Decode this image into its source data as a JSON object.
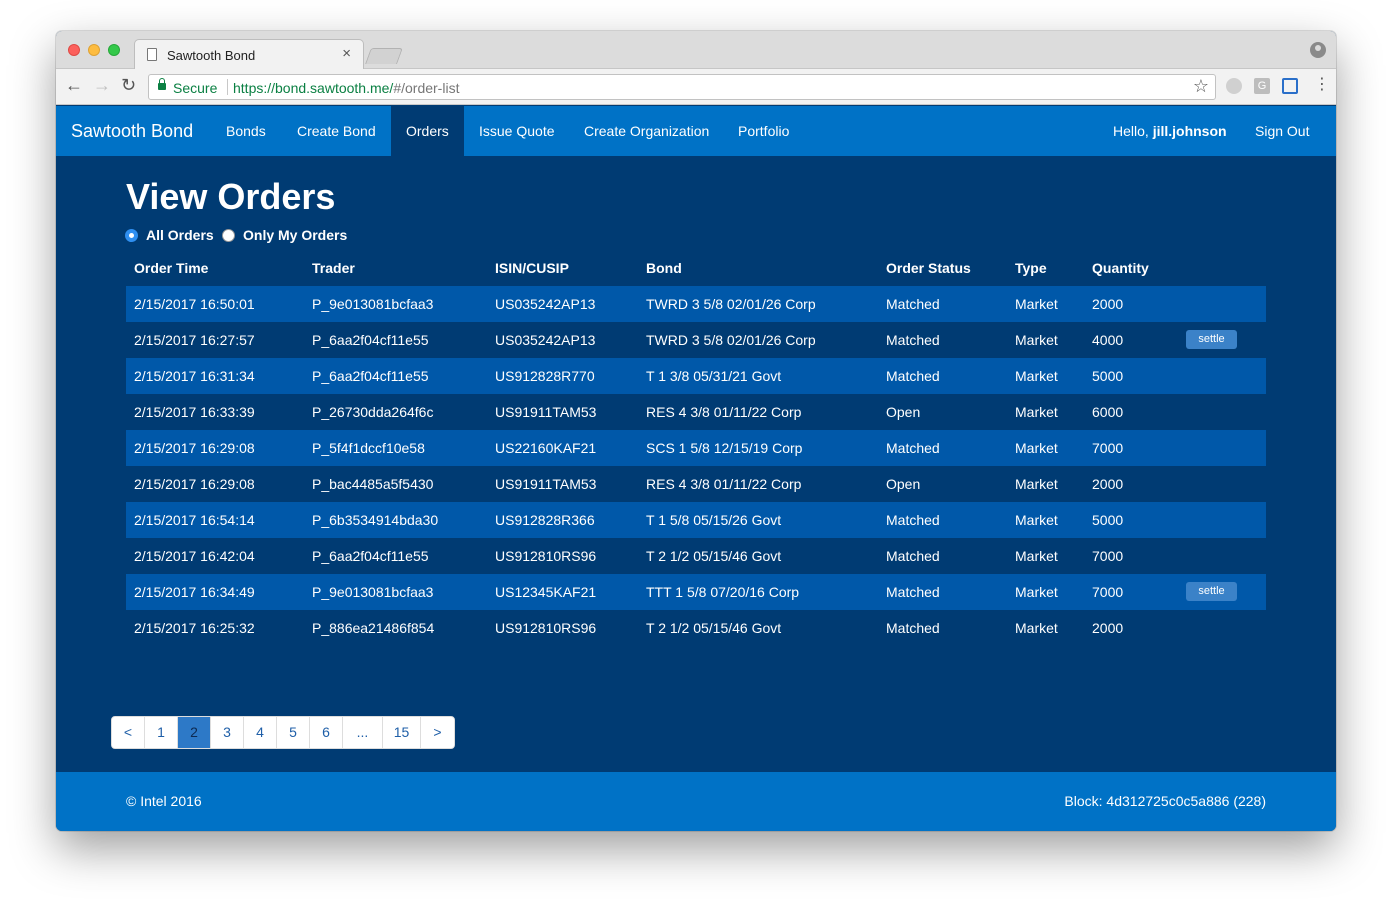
{
  "browser": {
    "tab_title": "Sawtooth Bond",
    "tab_close": "×",
    "secure_label": "Secure",
    "url_origin": "https://bond.sawtooth.me/",
    "url_path": "#/order-list",
    "ext2_label": "G"
  },
  "navbar": {
    "brand": "Sawtooth Bond",
    "items": [
      {
        "label": "Bonds"
      },
      {
        "label": "Create Bond"
      },
      {
        "label": "Orders",
        "active": true
      },
      {
        "label": "Issue Quote"
      },
      {
        "label": "Create Organization"
      },
      {
        "label": "Portfolio"
      }
    ],
    "hello_prefix": "Hello, ",
    "username": "jill.johnson",
    "sign_out": "Sign Out",
    "accent_color": "#0072c6"
  },
  "main": {
    "title": "View Orders",
    "filters": {
      "all_orders": "All Orders",
      "only_my_orders": "Only My Orders",
      "selected": "all_orders"
    },
    "columns": [
      "Order Time",
      "Trader",
      "ISIN/CUSIP",
      "Bond",
      "Order Status",
      "Type",
      "Quantity"
    ],
    "settle_label": "settle",
    "rows": [
      {
        "time": "2/15/2017 16:50:01",
        "trader": "P_9e013081bcfaa3",
        "isin": "US035242AP13",
        "bond": "TWRD 3 5/8 02/01/26 Corp",
        "status": "Matched",
        "type": "Market",
        "qty": "2000",
        "settle": false
      },
      {
        "time": "2/15/2017 16:27:57",
        "trader": "P_6aa2f04cf11e55",
        "isin": "US035242AP13",
        "bond": "TWRD 3 5/8 02/01/26 Corp",
        "status": "Matched",
        "type": "Market",
        "qty": "4000",
        "settle": true
      },
      {
        "time": "2/15/2017 16:31:34",
        "trader": "P_6aa2f04cf11e55",
        "isin": "US912828R770",
        "bond": "T 1 3/8 05/31/21 Govt",
        "status": "Matched",
        "type": "Market",
        "qty": "5000",
        "settle": false
      },
      {
        "time": "2/15/2017 16:33:39",
        "trader": "P_26730dda264f6c",
        "isin": "US91911TAM53",
        "bond": "RES 4 3/8 01/11/22 Corp",
        "status": "Open",
        "type": "Market",
        "qty": "6000",
        "settle": false
      },
      {
        "time": "2/15/2017 16:29:08",
        "trader": "P_5f4f1dccf10e58",
        "isin": "US22160KAF21",
        "bond": "SCS 1 5/8 12/15/19 Corp",
        "status": "Matched",
        "type": "Market",
        "qty": "7000",
        "settle": false
      },
      {
        "time": "2/15/2017 16:29:08",
        "trader": "P_bac4485a5f5430",
        "isin": "US91911TAM53",
        "bond": "RES 4 3/8 01/11/22 Corp",
        "status": "Open",
        "type": "Market",
        "qty": "2000",
        "settle": false
      },
      {
        "time": "2/15/2017 16:54:14",
        "trader": "P_6b3534914bda30",
        "isin": "US912828R366",
        "bond": "T 1 5/8 05/15/26 Govt",
        "status": "Matched",
        "type": "Market",
        "qty": "5000",
        "settle": false
      },
      {
        "time": "2/15/2017 16:42:04",
        "trader": "P_6aa2f04cf11e55",
        "isin": "US912810RS96",
        "bond": "T 2 1/2 05/15/46 Govt",
        "status": "Matched",
        "type": "Market",
        "qty": "7000",
        "settle": false
      },
      {
        "time": "2/15/2017 16:34:49",
        "trader": "P_9e013081bcfaa3",
        "isin": "US12345KAF21",
        "bond": "TTT 1 5/8 07/20/16 Corp",
        "status": "Matched",
        "type": "Market",
        "qty": "7000",
        "settle": true
      },
      {
        "time": "2/15/2017 16:25:32",
        "trader": "P_886ea21486f854",
        "isin": "US912810RS96",
        "bond": "T 2 1/2 05/15/46 Govt",
        "status": "Matched",
        "type": "Market",
        "qty": "2000",
        "settle": false
      }
    ],
    "pagination": [
      {
        "label": "<"
      },
      {
        "label": "1"
      },
      {
        "label": "2",
        "active": true
      },
      {
        "label": "3"
      },
      {
        "label": "4"
      },
      {
        "label": "5"
      },
      {
        "label": "6"
      },
      {
        "label": "..."
      },
      {
        "label": "15"
      },
      {
        "label": ">"
      }
    ]
  },
  "footer": {
    "copyright": "© Intel 2016",
    "block": "Block: 4d312725c0c5a886 (228)"
  }
}
